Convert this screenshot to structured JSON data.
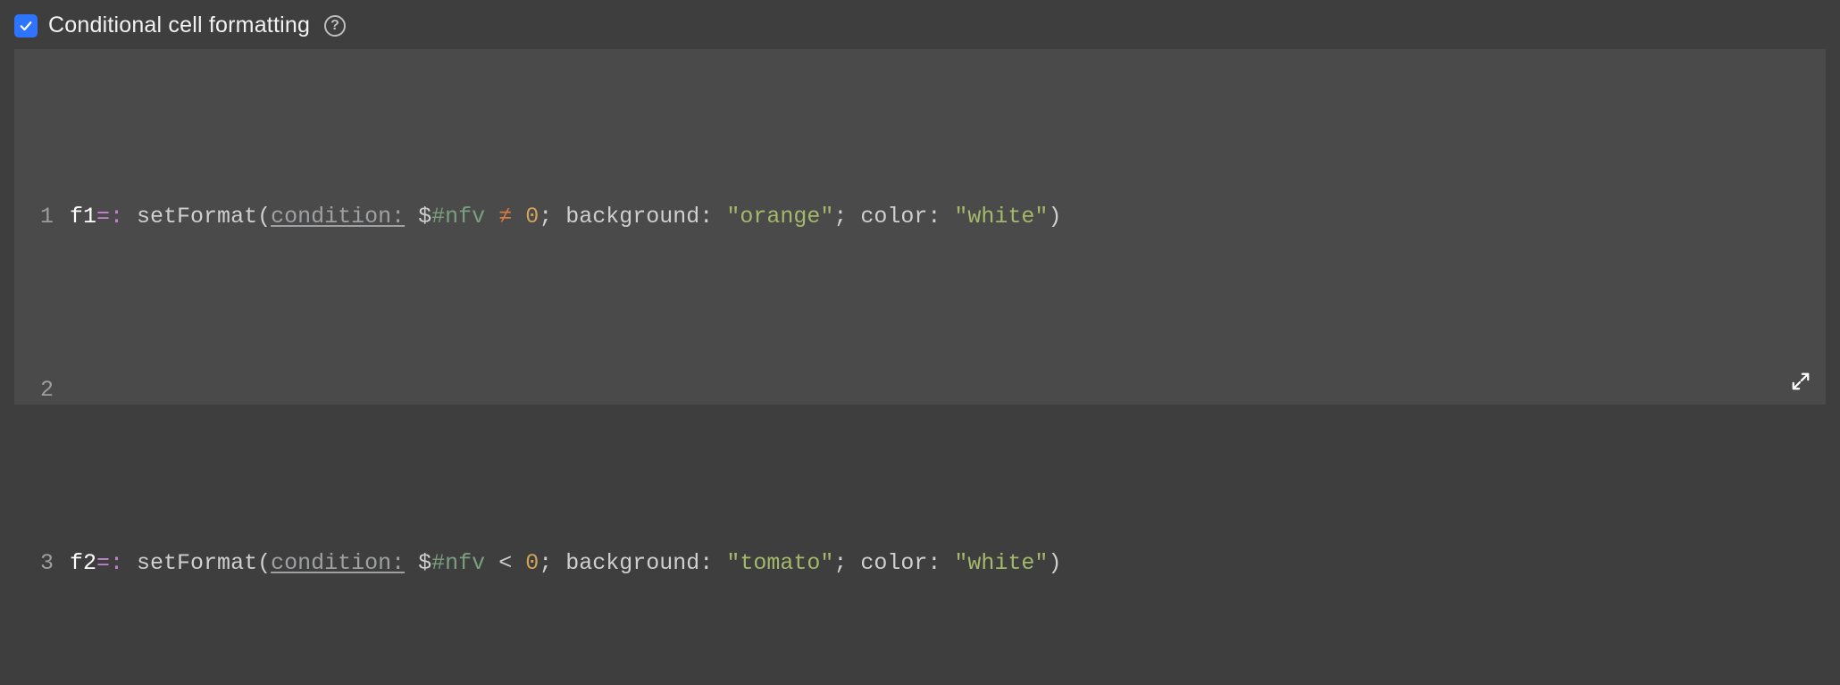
{
  "header": {
    "checked": true,
    "title": "Conditional cell formatting",
    "help_glyph": "?"
  },
  "editor": {
    "lines": [
      {
        "num": "1",
        "tokens": {
          "var": "f1",
          "def": "=:",
          "fn": "setFormat",
          "open": "(",
          "param1": "condition:",
          "dollar": "$",
          "special": "#nfv",
          "op": "≠",
          "num": "0",
          "sep1": ";",
          "key2": "background:",
          "str2": "\"orange\"",
          "sep2": ";",
          "key3": "color:",
          "str3": "\"white\"",
          "close": ")"
        }
      },
      {
        "num": "2",
        "blank": true
      },
      {
        "num": "3",
        "tokens": {
          "var": "f2",
          "def": "=:",
          "fn": "setFormat",
          "open": "(",
          "param1": "condition:",
          "dollar": "$",
          "special": "#nfv",
          "op": "<",
          "num": "0",
          "sep1": ";",
          "key2": "background:",
          "str2": "\"tomato\"",
          "sep2": ";",
          "key3": "color:",
          "str3": "\"white\"",
          "close": ")"
        }
      }
    ]
  },
  "colors": {
    "bg_outer": "#3e3e3e",
    "bg_editor": "#4a4a4a",
    "checkbox": "#2f74ff",
    "var": "#ffffff",
    "def": "#c481d1",
    "param": "#9fa0a2",
    "special": "#7a9e7e",
    "op_ne": "#d97b3e",
    "num": "#cfa35a",
    "str": "#a4b86a"
  }
}
